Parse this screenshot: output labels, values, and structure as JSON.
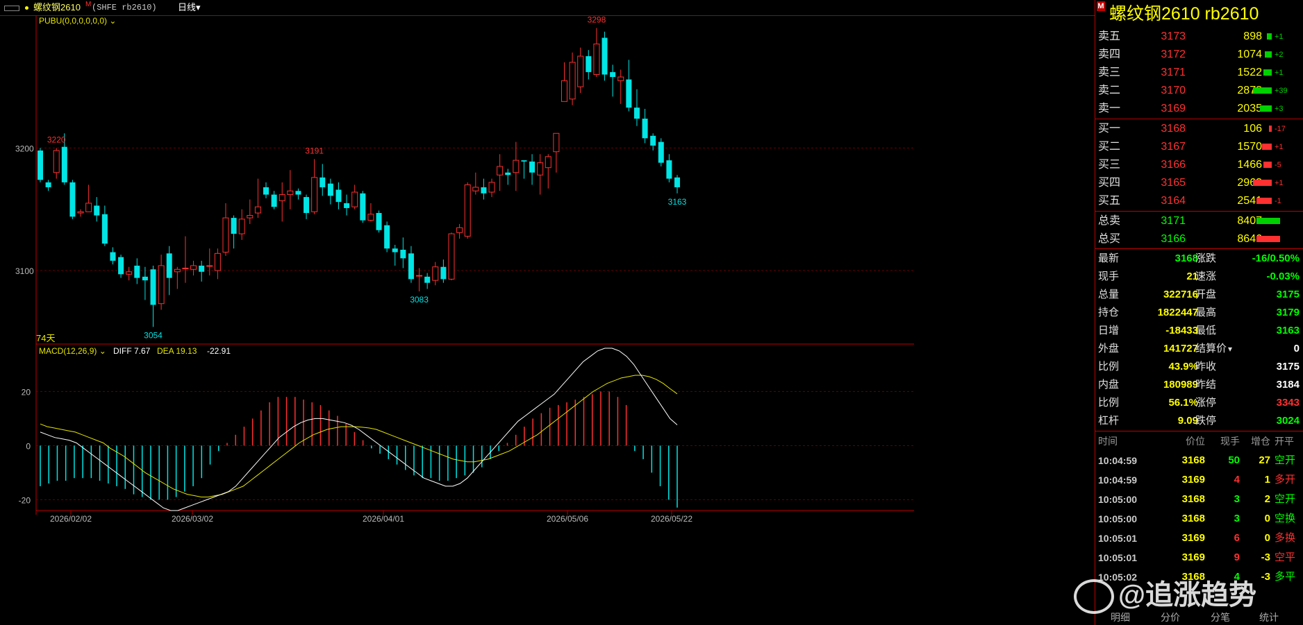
{
  "title_bar": {
    "name": "螺纹钢2610",
    "marker": "M",
    "code": "(SHFE rb2610)",
    "period": "日线"
  },
  "chart": {
    "indicator_label": "PUBU(0,0,0,0,0,0)",
    "days_label": "74天",
    "y_ticks": [
      "3200",
      "3100"
    ],
    "x_ticks": [
      "2026/02/02",
      "2026/03/02",
      "2026/04/01",
      "2026/05/06",
      "2026/05/22"
    ],
    "annotations": [
      "3220",
      "3191",
      "3298",
      "3054",
      "3083",
      "3163"
    ],
    "macd": {
      "label": "MACD(12,26,9)",
      "diff_label": "DIFF 7.67",
      "dea_label": "DEA 19.13",
      "macd_value": "-22.91",
      "y_ticks": [
        "20",
        "0",
        "-20"
      ]
    },
    "colors": {
      "up": "#ff3030",
      "down": "#00e5e5",
      "diff": "#ffffff",
      "dea": "#e6e600"
    }
  },
  "chart_data": {
    "type": "candlestick",
    "candles": [
      [
        3198,
        3174,
        3200,
        3172
      ],
      [
        3172,
        3168,
        3174,
        3165
      ],
      [
        3180,
        3198,
        3200,
        3175
      ],
      [
        3201,
        3172,
        3212,
        3170
      ],
      [
        3172,
        3144,
        3174,
        3142
      ],
      [
        3147,
        3148,
        3150,
        3144
      ],
      [
        3148,
        3155,
        3170,
        3148
      ],
      [
        3153,
        3145,
        3160,
        3140
      ],
      [
        3146,
        3122,
        3153,
        3120
      ],
      [
        3115,
        3108,
        3119,
        3105
      ],
      [
        3111,
        3097,
        3113,
        3094
      ],
      [
        3097,
        3099,
        3103,
        3092
      ],
      [
        3104,
        3094,
        3110,
        3089
      ],
      [
        3095,
        3092,
        3103,
        3076
      ],
      [
        3101,
        3072,
        3104,
        3054
      ],
      [
        3073,
        3104,
        3113,
        3068
      ],
      [
        3114,
        3094,
        3120,
        3080
      ],
      [
        3099,
        3101,
        3103,
        3085
      ],
      [
        3102,
        3102,
        3128,
        3090
      ],
      [
        3101,
        3104,
        3108,
        3096
      ],
      [
        3104,
        3099,
        3108,
        3091
      ],
      [
        3104,
        3104,
        3118,
        3096
      ],
      [
        3100,
        3114,
        3118,
        3093
      ],
      [
        3115,
        3143,
        3155,
        3112
      ],
      [
        3143,
        3130,
        3145,
        3118
      ],
      [
        3130,
        3142,
        3150,
        3125
      ],
      [
        3143,
        3145,
        3158,
        3138
      ],
      [
        3147,
        3152,
        3175,
        3143
      ],
      [
        3168,
        3162,
        3172,
        3159
      ],
      [
        3162,
        3152,
        3165,
        3150
      ],
      [
        3157,
        3162,
        3172,
        3140
      ],
      [
        3162,
        3165,
        3182,
        3150
      ],
      [
        3165,
        3162,
        3167,
        3158
      ],
      [
        3160,
        3147,
        3162,
        3142
      ],
      [
        3148,
        3176,
        3191,
        3146
      ],
      [
        3176,
        3168,
        3187,
        3161
      ],
      [
        3171,
        3161,
        3175,
        3154
      ],
      [
        3166,
        3156,
        3172,
        3150
      ],
      [
        3155,
        3151,
        3162,
        3145
      ],
      [
        3152,
        3164,
        3170,
        3150
      ],
      [
        3163,
        3141,
        3165,
        3139
      ],
      [
        3141,
        3146,
        3155,
        3140
      ],
      [
        3147,
        3133,
        3149,
        3131
      ],
      [
        3137,
        3118,
        3140,
        3115
      ],
      [
        3118,
        3115,
        3121,
        3104
      ],
      [
        3117,
        3110,
        3127,
        3102
      ],
      [
        3114,
        3093,
        3120,
        3090
      ],
      [
        3096,
        3096,
        3102,
        3083
      ],
      [
        3095,
        3090,
        3098,
        3085
      ],
      [
        3092,
        3103,
        3107,
        3088
      ],
      [
        3103,
        3093,
        3109,
        3090
      ],
      [
        3093,
        3130,
        3131,
        3092
      ],
      [
        3131,
        3135,
        3138,
        3126
      ],
      [
        3128,
        3170,
        3172,
        3126
      ],
      [
        3165,
        3168,
        3180,
        3162
      ],
      [
        3168,
        3163,
        3175,
        3158
      ],
      [
        3164,
        3172,
        3175,
        3160
      ],
      [
        3178,
        3185,
        3195,
        3165
      ],
      [
        3180,
        3178,
        3183,
        3170
      ],
      [
        3180,
        3190,
        3205,
        3165
      ],
      [
        3190,
        3189,
        3190,
        3175
      ],
      [
        3189,
        3180,
        3195,
        3170
      ],
      [
        3178,
        3188,
        3195,
        3162
      ],
      [
        3184,
        3193,
        3195,
        3167
      ],
      [
        3197,
        3212,
        3212,
        3180
      ],
      [
        3238,
        3255,
        3270,
        3245
      ],
      [
        3240,
        3270,
        3278,
        3235
      ],
      [
        3250,
        3275,
        3282,
        3245
      ],
      [
        3275,
        3262,
        3280,
        3256
      ],
      [
        3260,
        3285,
        3298,
        3258
      ],
      [
        3290,
        3260,
        3295,
        3255
      ],
      [
        3262,
        3258,
        3268,
        3242
      ],
      [
        3255,
        3258,
        3264,
        3236
      ],
      [
        3256,
        3233,
        3272,
        3230
      ],
      [
        3233,
        3224,
        3248,
        3218
      ],
      [
        3224,
        3208,
        3232,
        3204
      ],
      [
        3210,
        3202,
        3212,
        3198
      ],
      [
        3205,
        3188,
        3208,
        3185
      ],
      [
        3190,
        3175,
        3195,
        3172
      ],
      [
        3176,
        3168,
        3178,
        3163
      ]
    ],
    "ylim": [
      3040,
      3305
    ],
    "macd_bars": [
      -15,
      -14,
      -13,
      -13,
      -12,
      -12,
      -12,
      -13,
      -14,
      -15,
      -16,
      -18,
      -19,
      -20,
      -20,
      -20,
      -19,
      -17,
      -15,
      -12,
      -7,
      -2,
      1,
      4,
      7,
      10,
      13,
      16,
      18,
      18,
      18,
      17,
      16,
      15,
      13,
      11,
      8,
      5,
      2,
      -1,
      -3,
      -5,
      -7,
      -9,
      -11,
      -12,
      -12,
      -13,
      -13,
      -12,
      -11,
      -10,
      -8,
      -5,
      -2,
      1,
      4,
      7,
      10,
      12,
      14,
      15,
      16,
      17,
      18,
      19,
      20,
      20,
      18,
      15,
      -2,
      -5,
      -10,
      -15,
      -20,
      -22.91
    ],
    "dea": [
      8,
      7,
      6.5,
      6,
      5.5,
      5,
      4,
      3,
      2,
      1,
      -1,
      -2.5,
      -4,
      -6,
      -8,
      -10,
      -11.5,
      -13,
      -14.5,
      -16,
      -17,
      -18,
      -18.5,
      -19,
      -19,
      -18.5,
      -18,
      -17,
      -16,
      -15,
      -13,
      -11,
      -9,
      -7,
      -5,
      -3,
      -1,
      1,
      2.5,
      4,
      5,
      6,
      6.5,
      7,
      7,
      7,
      6.8,
      6.5,
      6,
      5,
      4,
      3,
      2,
      1,
      0,
      -1,
      -2,
      -3,
      -4,
      -5,
      -5.5,
      -6,
      -6,
      -5.5,
      -5,
      -4,
      -3,
      -2,
      -0.5,
      1,
      2.5,
      4,
      6,
      8,
      10,
      12,
      14,
      16,
      18,
      20,
      21.5,
      23,
      24,
      25,
      25.5,
      26,
      26,
      25.5,
      24.5,
      23,
      21,
      19.13
    ],
    "diff": [
      5,
      4,
      3,
      2.5,
      2,
      1,
      -1,
      -3,
      -5,
      -7,
      -9,
      -11,
      -13,
      -15,
      -17,
      -19,
      -21,
      -23,
      -24,
      -24,
      -23,
      -22,
      -21,
      -20,
      -19,
      -18,
      -17,
      -15,
      -12,
      -9,
      -6,
      -3,
      0,
      3,
      5,
      7,
      8.5,
      9.5,
      10,
      10,
      9.5,
      9,
      8.5,
      7.5,
      6,
      4,
      2,
      0,
      -2,
      -4,
      -6,
      -8,
      -10,
      -12,
      -13,
      -14,
      -15,
      -15,
      -14,
      -12,
      -9,
      -6,
      -3,
      0,
      3,
      6,
      9,
      11,
      13,
      15,
      17,
      19,
      22,
      25,
      28,
      31,
      33,
      35,
      36,
      36,
      35,
      33,
      30,
      26,
      22,
      18,
      14,
      10,
      7.67
    ],
    "series": [
      {
        "name": "DIFF"
      },
      {
        "name": "DEA"
      }
    ]
  },
  "panel": {
    "title": "螺纹钢2610  rb2610",
    "marker": "M",
    "asks": [
      {
        "label": "卖五",
        "price": "3173",
        "vol": "898",
        "chg": "+1",
        "bar": 0.22
      },
      {
        "label": "卖四",
        "price": "3172",
        "vol": "1074",
        "chg": "+2",
        "bar": 0.3
      },
      {
        "label": "卖三",
        "price": "3171",
        "vol": "1522",
        "chg": "+1",
        "bar": 0.35
      },
      {
        "label": "卖二",
        "price": "3170",
        "vol": "2878",
        "chg": "+39",
        "bar": 0.78
      },
      {
        "label": "卖一",
        "price": "3169",
        "vol": "2035",
        "chg": "+3",
        "bar": 0.5
      }
    ],
    "bids": [
      {
        "label": "买一",
        "price": "3168",
        "vol": "106",
        "chg": "-17",
        "bar": 0.05
      },
      {
        "label": "买二",
        "price": "3167",
        "vol": "1570",
        "chg": "+1",
        "bar": 0.4
      },
      {
        "label": "买三",
        "price": "3166",
        "vol": "1466",
        "chg": "-5",
        "bar": 0.35
      },
      {
        "label": "买四",
        "price": "3165",
        "vol": "2963",
        "chg": "+1",
        "bar": 0.8
      },
      {
        "label": "买五",
        "price": "3164",
        "vol": "2541",
        "chg": "-1",
        "bar": 0.65
      }
    ],
    "totals": [
      {
        "label": "总卖",
        "price": "3171",
        "vol": "8407",
        "bar": 0.8,
        "color": "#00d000"
      },
      {
        "label": "总买",
        "price": "3166",
        "vol": "8646",
        "bar": 0.8,
        "color": "#ff3030"
      }
    ],
    "quote": [
      {
        "l1": "最新",
        "v1": "3168",
        "c1": "#00ff00",
        "l2": "涨跌",
        "v2": "-16/0.50%",
        "c2": "#00ff00"
      },
      {
        "l1": "现手",
        "v1": "21",
        "c1": "#ffff00",
        "l2": "速涨",
        "v2": "-0.03%",
        "c2": "#00ff00"
      },
      {
        "l1": "总量",
        "v1": "322716",
        "c1": "#ffff00",
        "l2": "开盘",
        "v2": "3175",
        "c2": "#00ff00"
      },
      {
        "l1": "持仓",
        "v1": "1822447",
        "c1": "#ffff00",
        "l2": "最高",
        "v2": "3179",
        "c2": "#00ff00"
      },
      {
        "l1": "日增",
        "v1": "-18433",
        "c1": "#ffff00",
        "l2": "最低",
        "v2": "3163",
        "c2": "#00ff00"
      },
      {
        "l1": "外盘",
        "v1": "141727",
        "c1": "#ffff00",
        "l2": "结算价",
        "v2": "0",
        "c2": "#ffffff"
      },
      {
        "l1": "比例",
        "v1": "43.9%",
        "c1": "#ffff00",
        "l2": "昨收",
        "v2": "3175",
        "c2": "#ffffff"
      },
      {
        "l1": "内盘",
        "v1": "180989",
        "c1": "#ffff00",
        "l2": "昨结",
        "v2": "3184",
        "c2": "#ffffff"
      },
      {
        "l1": "比例",
        "v1": "56.1%",
        "c1": "#ffff00",
        "l2": "涨停",
        "v2": "3343",
        "c2": "#ff3030"
      },
      {
        "l1": "杠杆",
        "v1": "9.09",
        "c1": "#ffff00",
        "l2": "跌停",
        "v2": "3024",
        "c2": "#00ff00"
      }
    ],
    "trades_header": [
      "时间",
      "价位",
      "现手",
      "增仓",
      "开平"
    ],
    "trades": [
      {
        "time": "10:04:59",
        "price": "3168",
        "vol": "50",
        "vc": "#00ff00",
        "oi": "27",
        "type": "空开",
        "tc": "#00ff00"
      },
      {
        "time": "10:04:59",
        "price": "3169",
        "vol": "4",
        "vc": "#ff3030",
        "oi": "1",
        "type": "多开",
        "tc": "#ff3030"
      },
      {
        "time": "10:05:00",
        "price": "3168",
        "vol": "3",
        "vc": "#00ff00",
        "oi": "2",
        "type": "空开",
        "tc": "#00ff00"
      },
      {
        "time": "10:05:00",
        "price": "3168",
        "vol": "3",
        "vc": "#00ff00",
        "oi": "0",
        "type": "空换",
        "tc": "#00ff00"
      },
      {
        "time": "10:05:01",
        "price": "3169",
        "vol": "6",
        "vc": "#ff3030",
        "oi": "0",
        "type": "多换",
        "tc": "#ff3030"
      },
      {
        "time": "10:05:01",
        "price": "3169",
        "vol": "9",
        "vc": "#ff3030",
        "oi": "-3",
        "type": "空平",
        "tc": "#ff3030"
      },
      {
        "time": "10:05:02",
        "price": "3168",
        "vol": "4",
        "vc": "#00ff00",
        "oi": "-3",
        "type": "多平",
        "tc": "#00ff00"
      }
    ],
    "tabs": [
      "明细",
      "分价",
      "分笔",
      "统计"
    ]
  },
  "watermark": "@追涨趋势"
}
